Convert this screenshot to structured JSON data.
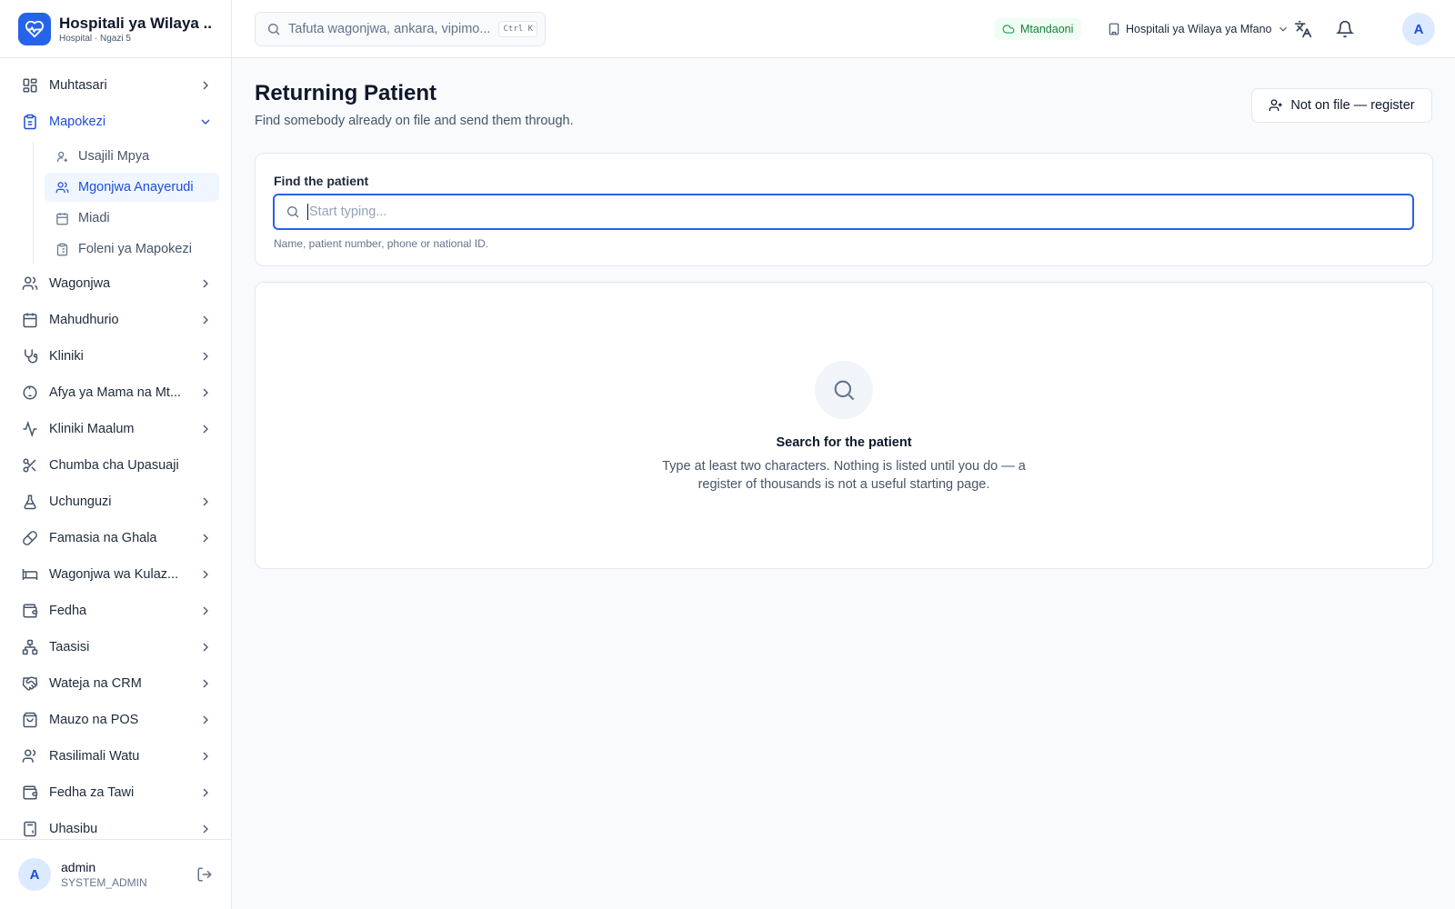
{
  "brand": {
    "title": "Hospitali ya Wilaya ...",
    "subtitle": "Hospital · Ngazi 5"
  },
  "topbar": {
    "search_placeholder": "Tafuta wagonjwa, ankara, vipimo...",
    "shortcut": "Ctrl K",
    "status": "Mtandaoni",
    "facility": "Hospitali ya Wilaya ya Mfano",
    "avatar_initial": "A"
  },
  "sidebar": {
    "items": [
      {
        "label": "Muhtasari",
        "icon": "dashboard-icon"
      },
      {
        "label": "Mapokezi",
        "icon": "clipboard-icon",
        "expanded": true
      },
      {
        "label": "Wagonjwa",
        "icon": "users-icon"
      },
      {
        "label": "Mahudhurio",
        "icon": "calendar-icon"
      },
      {
        "label": "Kliniki",
        "icon": "stethoscope-icon"
      },
      {
        "label": "Afya ya Mama na Mt...",
        "icon": "baby-icon"
      },
      {
        "label": "Kliniki Maalum",
        "icon": "activity-icon"
      },
      {
        "label": "Chumba cha Upasuaji",
        "icon": "scissors-icon"
      },
      {
        "label": "Uchunguzi",
        "icon": "flask-icon"
      },
      {
        "label": "Famasia na Ghala",
        "icon": "pill-icon"
      },
      {
        "label": "Wagonjwa wa Kulaz...",
        "icon": "bed-icon"
      },
      {
        "label": "Fedha",
        "icon": "wallet-icon"
      },
      {
        "label": "Taasisi",
        "icon": "network-icon"
      },
      {
        "label": "Wateja na CRM",
        "icon": "handshake-icon"
      },
      {
        "label": "Mauzo na POS",
        "icon": "shopping-bag-icon"
      },
      {
        "label": "Rasilimali Watu",
        "icon": "user-icon"
      },
      {
        "label": "Fedha za Tawi",
        "icon": "wallet-icon"
      },
      {
        "label": "Uhasibu",
        "icon": "calculator-icon"
      }
    ],
    "subitems": [
      {
        "label": "Usajili Mpya",
        "icon": "user-plus-icon"
      },
      {
        "label": "Mgonjwa Anayerudi",
        "icon": "users-icon",
        "active": true
      },
      {
        "label": "Miadi",
        "icon": "calendar-icon"
      },
      {
        "label": "Foleni ya Mapokezi",
        "icon": "clipboard-list-icon"
      }
    ],
    "user": {
      "initial": "A",
      "name": "admin",
      "role": "SYSTEM_ADMIN"
    }
  },
  "main": {
    "title": "Returning Patient",
    "subtitle": "Find somebody already on file and send them through.",
    "register_button": "Not on file — register",
    "find": {
      "label": "Find the patient",
      "placeholder": "Start typing...",
      "value": "",
      "hint": "Name, patient number, phone or national ID."
    },
    "empty": {
      "title": "Search for the patient",
      "description": "Type at least two characters. Nothing is listed until you do — a register of thousands is not a useful starting page."
    }
  },
  "colors": {
    "accent": "#2563eb",
    "active_bg": "#eff6ff",
    "status_green": "#15803d"
  }
}
